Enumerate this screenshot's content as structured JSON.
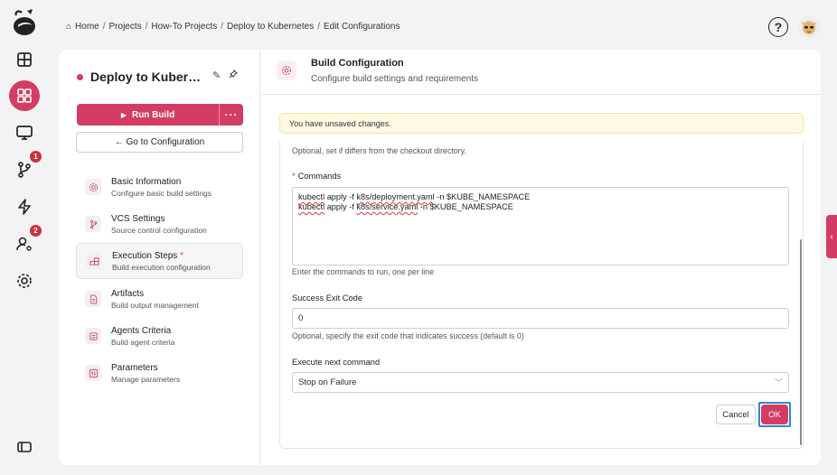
{
  "breadcrumb": {
    "items": [
      "Home",
      "Projects",
      "How-To Projects",
      "Deploy to Kubernetes",
      "Edit Configurations"
    ]
  },
  "header": {
    "help_label": "?"
  },
  "rail": {
    "badges": {
      "vcs": "1",
      "users": "2"
    }
  },
  "project": {
    "name": "Deploy to Kubernetes",
    "run_label": "Run Build",
    "more_label": "···",
    "goto_label": "← Go to Configuration"
  },
  "nav": {
    "items": [
      {
        "title": "Basic Information",
        "subtitle": "Configure basic build settings",
        "icon": "gear-icon"
      },
      {
        "title": "VCS Settings",
        "subtitle": "Source control configuration",
        "icon": "branch-icon"
      },
      {
        "title": "Execution Steps",
        "subtitle": "Build execution configuration",
        "icon": "steps-icon",
        "required_mark": "*"
      },
      {
        "title": "Artifacts",
        "subtitle": "Build output management",
        "icon": "file-icon"
      },
      {
        "title": "Agents Criteria",
        "subtitle": "Build agent criteria",
        "icon": "agent-icon"
      },
      {
        "title": "Parameters",
        "subtitle": "Manage parameters",
        "icon": "parameters-icon"
      }
    ]
  },
  "content": {
    "title": "Build Configuration",
    "subtitle": "Configure build settings and requirements",
    "warning": "You have unsaved changes.",
    "workdir_hint": "Optional, set if differs from the checkout directory.",
    "commands": {
      "required_mark": "*",
      "label": "Commands",
      "lines": [
        "kubectl apply -f k8s/deployment.yaml -n $KUBE_NAMESPACE",
        "kubectl apply -f k8s/service.yaml -n $KUBE_NAMESPACE"
      ],
      "hint": "Enter the commands to run, one per line"
    },
    "exit_code": {
      "label": "Success Exit Code",
      "value": "0",
      "hint": "Optional, specify the exit code that indicates success (default is 0)"
    },
    "next_command": {
      "label": "Execute next command",
      "value": "Stop on Failure"
    },
    "cancel_label": "Cancel",
    "ok_label": "OK"
  },
  "colors": {
    "accent": "#d33d63",
    "warning_bg": "#fff9e3",
    "focus": "#2f86d6"
  }
}
